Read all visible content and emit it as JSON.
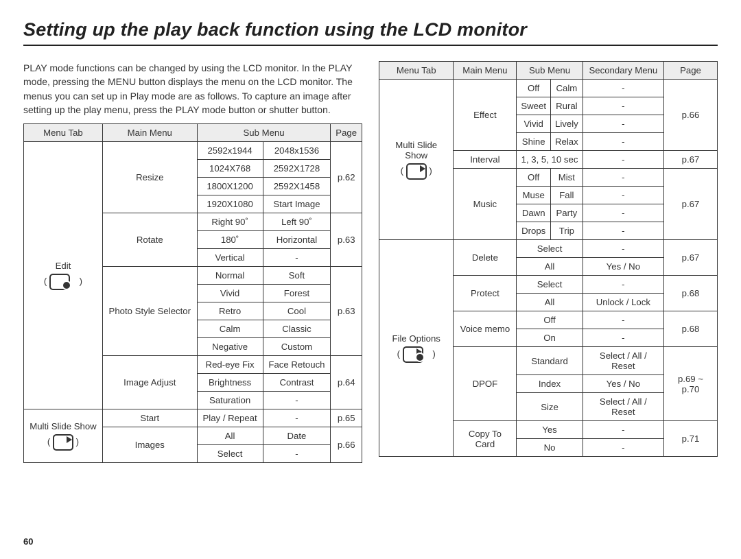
{
  "pageNumber": "60",
  "title": "Setting up the play back function using the LCD monitor",
  "intro": "PLAY mode functions can be changed by using the LCD monitor. In the PLAY mode, pressing the MENU button displays the menu on the LCD monitor. The menus you can set up in Play mode are as follows. To capture an image after setting up the play menu, press the PLAY mode button or shutter button.",
  "t1": {
    "headers": [
      "Menu Tab",
      "Main Menu",
      "Sub Menu",
      "Page"
    ],
    "rows": {
      "editTab": "Edit",
      "resize": "Resize",
      "resizeCells": [
        "2592x1944",
        "2048x1536",
        "1024X768",
        "2592X1728",
        "1800X1200",
        "2592X1458",
        "1920X1080",
        "Start Image"
      ],
      "resizePage": "p.62",
      "rotate": "Rotate",
      "rotateCells": [
        "Right 90˚",
        "Left 90˚",
        "180˚",
        "Horizontal",
        "Vertical",
        "-"
      ],
      "rotatePage": "p.63",
      "style": "Photo Style Selector",
      "styleCells": [
        "Normal",
        "Soft",
        "Vivid",
        "Forest",
        "Retro",
        "Cool",
        "Calm",
        "Classic",
        "Negative",
        "Custom"
      ],
      "stylePage": "p.63",
      "adjust": "Image Adjust",
      "adjustCells": [
        "Red-eye Fix",
        "Face Retouch",
        "Brightness",
        "Contrast",
        "Saturation",
        "-"
      ],
      "adjustPage": "p.64",
      "mssTab": "Multi Slide Show",
      "start": "Start",
      "startCells": [
        "Play / Repeat",
        "-"
      ],
      "startPage": "p.65",
      "images": "Images",
      "imagesCells": [
        "All",
        "Date",
        "Select",
        "-"
      ],
      "imagesPage": "p.66"
    }
  },
  "t2": {
    "headers": [
      "Menu Tab",
      "Main Menu",
      "Sub Menu",
      "Secondary Menu",
      "Page"
    ],
    "rows": {
      "mssTab": "Multi Slide Show",
      "effect": "Effect",
      "effectCells": [
        "Off",
        "Calm",
        "-",
        "Sweet",
        "Rural",
        "-",
        "Vivid",
        "Lively",
        "-",
        "Shine",
        "Relax",
        "-"
      ],
      "effectPage": "p.66",
      "interval": "Interval",
      "intervalCells": [
        "1, 3, 5, 10 sec",
        "-"
      ],
      "intervalPage": "p.67",
      "music": "Music",
      "musicCells": [
        "Off",
        "Mist",
        "-",
        "Muse",
        "Fall",
        "-",
        "Dawn",
        "Party",
        "-",
        "Drops",
        "Trip",
        "-"
      ],
      "musicPage": "p.67",
      "fileTab": "File Options",
      "delete": "Delete",
      "deleteCells": [
        "Select",
        "-",
        "All",
        "Yes / No"
      ],
      "deletePage": "p.67",
      "protect": "Protect",
      "protectCells": [
        "Select",
        "-",
        "All",
        "Unlock / Lock"
      ],
      "protectPage": "p.68",
      "voice": "Voice memo",
      "voiceCells": [
        "Off",
        "-",
        "On",
        "-"
      ],
      "voicePage": "p.68",
      "dpof": "DPOF",
      "dpofCells": [
        "Standard",
        "Select / All / Reset",
        "Index",
        "Yes / No",
        "Size",
        "Select / All / Reset"
      ],
      "dpofPage": "p.69 ~ p.70",
      "copy": "Copy To Card",
      "copyCells": [
        "Yes",
        "-",
        "No",
        "-"
      ],
      "copyPage": "p.71"
    }
  },
  "chart_data": [
    {
      "type": "table",
      "title": "Play mode menu — left page",
      "columns": [
        "Menu Tab",
        "Main Menu",
        "Sub Menu (col A)",
        "Sub Menu (col B)",
        "Page"
      ],
      "rows": [
        [
          "Edit",
          "Resize",
          "2592x1944",
          "2048x1536",
          "p.62"
        ],
        [
          "Edit",
          "Resize",
          "1024X768",
          "2592X1728",
          "p.62"
        ],
        [
          "Edit",
          "Resize",
          "1800X1200",
          "2592X1458",
          "p.62"
        ],
        [
          "Edit",
          "Resize",
          "1920X1080",
          "Start Image",
          "p.62"
        ],
        [
          "Edit",
          "Rotate",
          "Right 90˚",
          "Left 90˚",
          "p.63"
        ],
        [
          "Edit",
          "Rotate",
          "180˚",
          "Horizontal",
          "p.63"
        ],
        [
          "Edit",
          "Rotate",
          "Vertical",
          "-",
          "p.63"
        ],
        [
          "Edit",
          "Photo Style Selector",
          "Normal",
          "Soft",
          "p.63"
        ],
        [
          "Edit",
          "Photo Style Selector",
          "Vivid",
          "Forest",
          "p.63"
        ],
        [
          "Edit",
          "Photo Style Selector",
          "Retro",
          "Cool",
          "p.63"
        ],
        [
          "Edit",
          "Photo Style Selector",
          "Calm",
          "Classic",
          "p.63"
        ],
        [
          "Edit",
          "Photo Style Selector",
          "Negative",
          "Custom",
          "p.63"
        ],
        [
          "Edit",
          "Image Adjust",
          "Red-eye Fix",
          "Face Retouch",
          "p.64"
        ],
        [
          "Edit",
          "Image Adjust",
          "Brightness",
          "Contrast",
          "p.64"
        ],
        [
          "Edit",
          "Image Adjust",
          "Saturation",
          "-",
          "p.64"
        ],
        [
          "Multi Slide Show",
          "Start",
          "Play / Repeat",
          "-",
          "p.65"
        ],
        [
          "Multi Slide Show",
          "Images",
          "All",
          "Date",
          "p.66"
        ],
        [
          "Multi Slide Show",
          "Images",
          "Select",
          "-",
          "p.66"
        ]
      ]
    },
    {
      "type": "table",
      "title": "Play mode menu — right page",
      "columns": [
        "Menu Tab",
        "Main Menu",
        "Sub Menu (col A)",
        "Sub Menu (col B)",
        "Secondary Menu",
        "Page"
      ],
      "rows": [
        [
          "Multi Slide Show",
          "Effect",
          "Off",
          "Calm",
          "-",
          "p.66"
        ],
        [
          "Multi Slide Show",
          "Effect",
          "Sweet",
          "Rural",
          "-",
          "p.66"
        ],
        [
          "Multi Slide Show",
          "Effect",
          "Vivid",
          "Lively",
          "-",
          "p.66"
        ],
        [
          "Multi Slide Show",
          "Effect",
          "Shine",
          "Relax",
          "-",
          "p.66"
        ],
        [
          "Multi Slide Show",
          "Interval",
          "1, 3, 5, 10 sec",
          "",
          "-",
          "p.67"
        ],
        [
          "Multi Slide Show",
          "Music",
          "Off",
          "Mist",
          "-",
          "p.67"
        ],
        [
          "Multi Slide Show",
          "Music",
          "Muse",
          "Fall",
          "-",
          "p.67"
        ],
        [
          "Multi Slide Show",
          "Music",
          "Dawn",
          "Party",
          "-",
          "p.67"
        ],
        [
          "Multi Slide Show",
          "Music",
          "Drops",
          "Trip",
          "-",
          "p.67"
        ],
        [
          "File Options",
          "Delete",
          "Select",
          "",
          "-",
          "p.67"
        ],
        [
          "File Options",
          "Delete",
          "All",
          "",
          "Yes / No",
          "p.67"
        ],
        [
          "File Options",
          "Protect",
          "Select",
          "",
          "-",
          "p.68"
        ],
        [
          "File Options",
          "Protect",
          "All",
          "",
          "Unlock / Lock",
          "p.68"
        ],
        [
          "File Options",
          "Voice memo",
          "Off",
          "",
          "-",
          "p.68"
        ],
        [
          "File Options",
          "Voice memo",
          "On",
          "",
          "-",
          "p.68"
        ],
        [
          "File Options",
          "DPOF",
          "Standard",
          "",
          "Select / All / Reset",
          "p.69 ~ p.70"
        ],
        [
          "File Options",
          "DPOF",
          "Index",
          "",
          "Yes / No",
          "p.69 ~ p.70"
        ],
        [
          "File Options",
          "DPOF",
          "Size",
          "",
          "Select / All / Reset",
          "p.69 ~ p.70"
        ],
        [
          "File Options",
          "Copy To Card",
          "Yes",
          "",
          "-",
          "p.71"
        ],
        [
          "File Options",
          "Copy To Card",
          "No",
          "",
          "-",
          "p.71"
        ]
      ]
    }
  ]
}
